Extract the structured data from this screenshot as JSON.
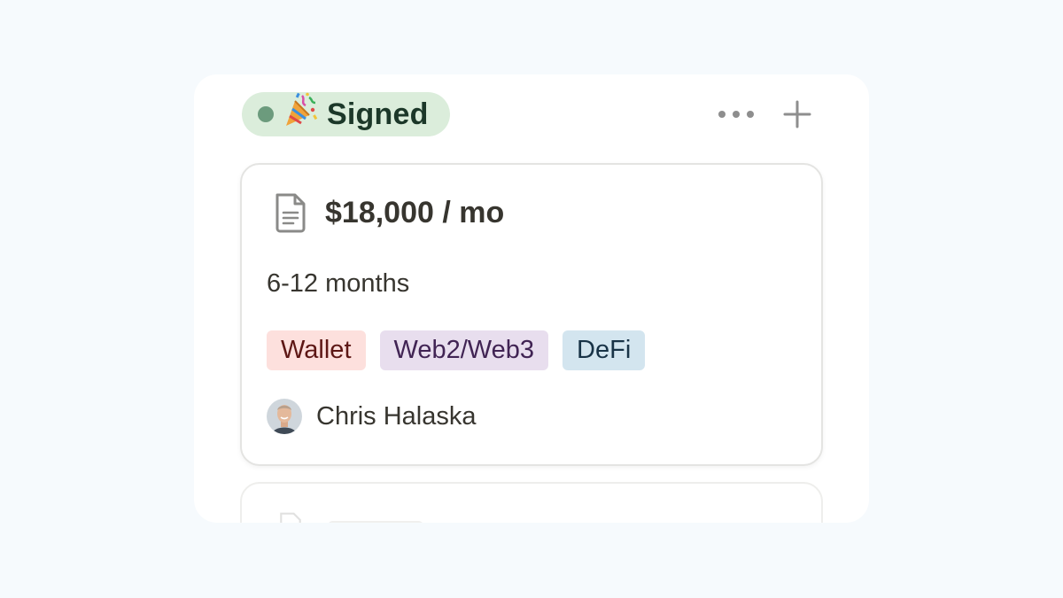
{
  "column": {
    "status_label": "Signed",
    "status_emoji": "party-popper",
    "status_color": "#dbeddb",
    "dot_color": "#6c9b7d",
    "more_icon": "ellipsis-horizontal-icon",
    "add_icon": "plus-icon"
  },
  "card": {
    "icon": "document-icon",
    "title": "$18,000 / mo",
    "duration": "6-12 months",
    "tags": [
      {
        "label": "Wallet",
        "bg": "#fde0dd",
        "fg": "#5d1715"
      },
      {
        "label": "Web2/Web3",
        "bg": "#e8deee",
        "fg": "#412454"
      },
      {
        "label": "DeFi",
        "bg": "#d3e5ef",
        "fg": "#183347"
      }
    ],
    "assignee": {
      "name": "Chris Halaska",
      "avatar": "avatar-photo"
    }
  }
}
